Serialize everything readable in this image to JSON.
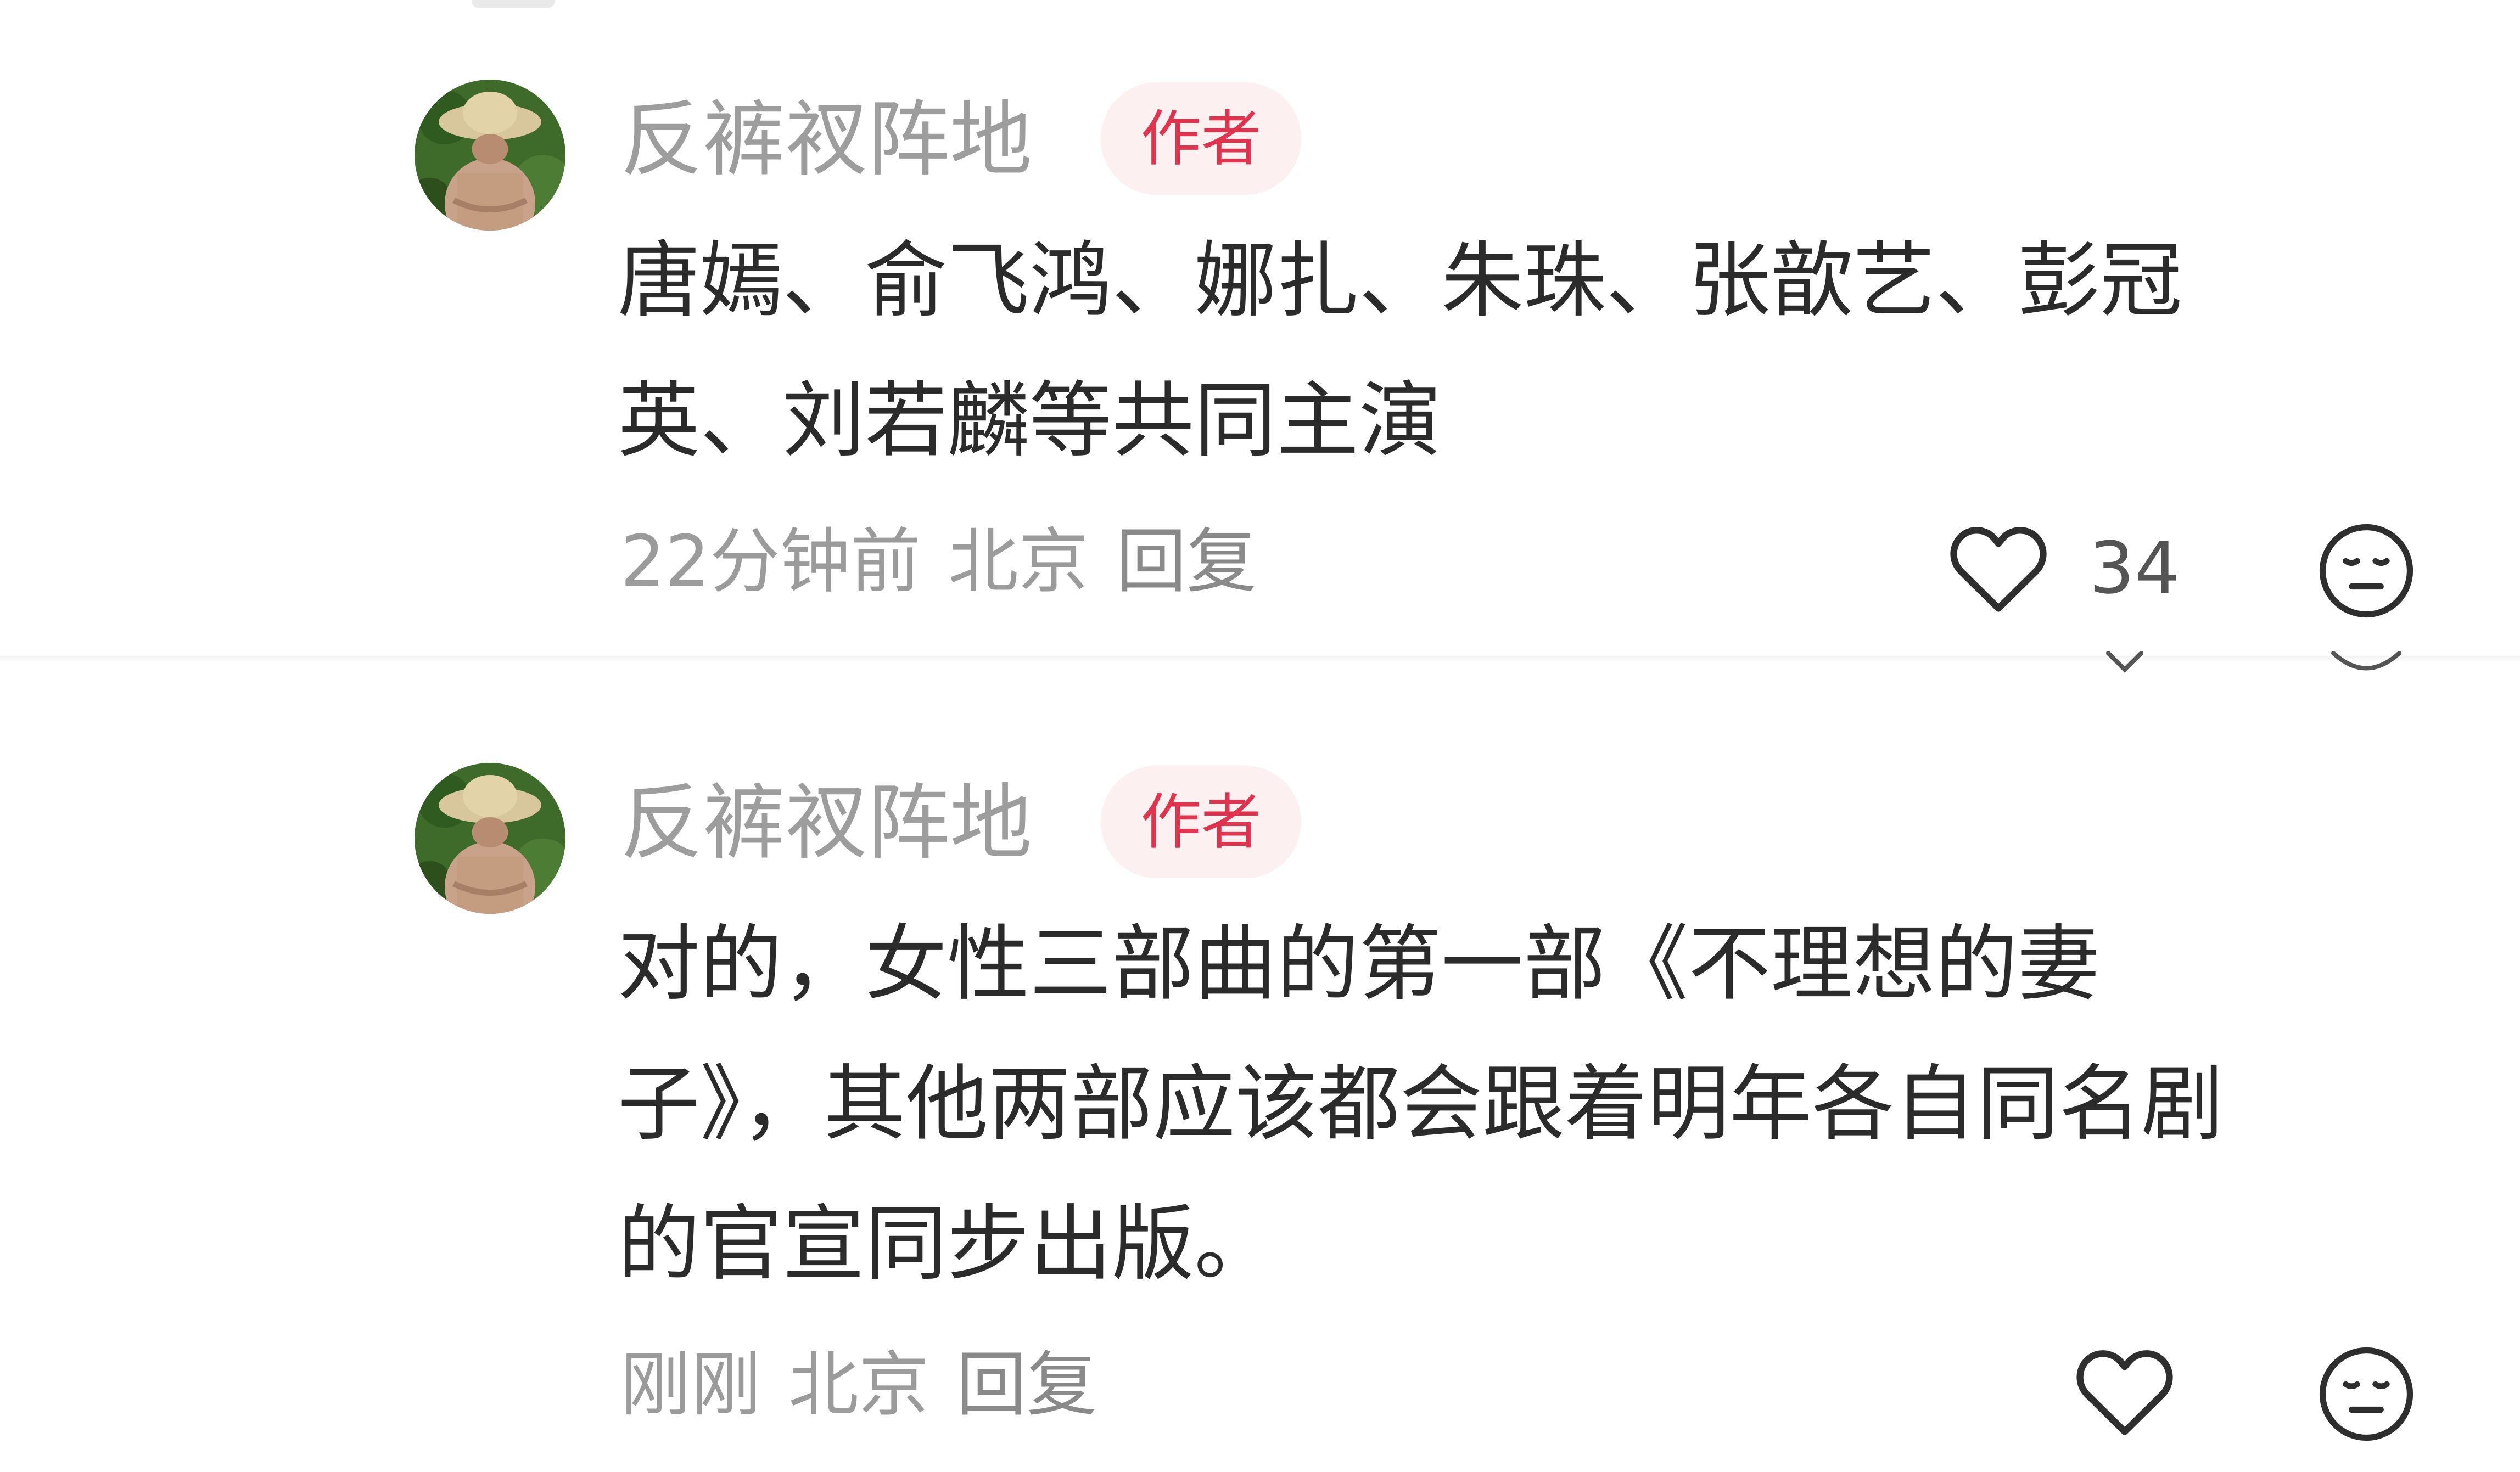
{
  "comments": [
    {
      "username": "反裤衩阵地",
      "badge": "作者",
      "text": "唐嫣、俞飞鸿、娜扎、朱珠、张歆艺、彭冠\n英、刘若麟等共同主演",
      "time": "22分钟前",
      "location": "北京",
      "reply_label": "回复",
      "like_count": "34"
    },
    {
      "username": "反裤衩阵地",
      "badge": "作者",
      "text": "对的，女性三部曲的第一部《不理想的妻\n子》，其他两部应该都会跟着明年各自同名剧\n的官宣同步出版。",
      "time": "刚刚",
      "location": "北京",
      "reply_label": "回复",
      "like_count": ""
    }
  ],
  "icons": {
    "like": "heart-outline-icon",
    "dislike": "meh-face-icon",
    "avatar": "straw-hat-person-avatar"
  },
  "colors": {
    "username": "#9d9d9d",
    "badge_text": "#e0344e",
    "badge_bg": "#fdf0f0",
    "body_text": "#2b2b2b",
    "meta_text": "#9b9b9b"
  }
}
